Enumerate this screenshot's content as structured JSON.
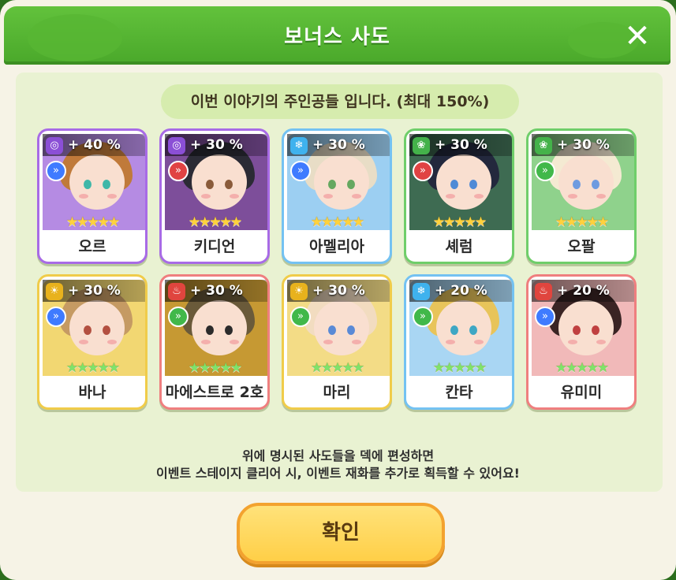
{
  "dialog": {
    "title": "보너스 사도",
    "close_icon": "close-icon",
    "banner": "이번 이야기의 주인공들 입니다. (최대 150%)",
    "description_line1": "위에 명시된 사도들을 덱에 편성하면",
    "description_line2": "이벤트 스테이지 클리어 시, 이벤트 재화를 추가로 획득할 수 있어요!",
    "confirm_label": "확인"
  },
  "characters": [
    {
      "name": "오르",
      "bonus": "+ 40 %",
      "element": "spiral",
      "element_color": "#8b4fd6",
      "rarity_stars": 5,
      "star_color": "yellow",
      "type_chip_color": "#3f7bff",
      "card_border": "#a86be6",
      "theme_bg": "#b58be3",
      "hair_color": "#c07a3a",
      "eye_color": "#3fb7a8"
    },
    {
      "name": "키디언",
      "bonus": "+ 30 %",
      "element": "spiral",
      "element_color": "#8b4fd6",
      "rarity_stars": 5,
      "star_color": "yellow",
      "type_chip_color": "#e04343",
      "card_border": "#a86be6",
      "theme_bg": "#7d4e9a",
      "hair_color": "#2b2b35",
      "eye_color": "#8a5b3a"
    },
    {
      "name": "아멜리아",
      "bonus": "+ 30 %",
      "element": "snowflake",
      "element_color": "#3fb2ee",
      "rarity_stars": 5,
      "star_color": "yellow",
      "type_chip_color": "#3f7bff",
      "card_border": "#74c2f2",
      "theme_bg": "#9ccff2",
      "hair_color": "#e8ddc6",
      "eye_color": "#65a860"
    },
    {
      "name": "셰럼",
      "bonus": "+ 30 %",
      "element": "leaf",
      "element_color": "#44b24a",
      "rarity_stars": 5,
      "star_color": "yellow",
      "type_chip_color": "#e04343",
      "card_border": "#6fce6a",
      "theme_bg": "#3e6b52",
      "hair_color": "#23283d",
      "eye_color": "#4f8ad6"
    },
    {
      "name": "오팔",
      "bonus": "+ 30 %",
      "element": "leaf",
      "element_color": "#44b24a",
      "rarity_stars": 5,
      "star_color": "yellow",
      "type_chip_color": "#41b84a",
      "card_border": "#6fce6a",
      "theme_bg": "#8fd28c",
      "hair_color": "#f4ead2",
      "eye_color": "#6e9be0"
    },
    {
      "name": "바나",
      "bonus": "+ 30 %",
      "element": "sun",
      "element_color": "#e8b21d",
      "rarity_stars": 5,
      "star_color": "green",
      "type_chip_color": "#3f7bff",
      "card_border": "#f0cc4a",
      "theme_bg": "#f2d772",
      "hair_color": "#c59a63",
      "eye_color": "#b35040"
    },
    {
      "name": "마에스트로 2호",
      "bonus": "+ 30 %",
      "element": "flame",
      "element_color": "#e0453e",
      "rarity_stars": 5,
      "star_color": "green",
      "type_chip_color": "#41b84a",
      "card_border": "#ef7f7f",
      "theme_bg": "#c69933",
      "hair_color": "#6a5a3a",
      "eye_color": "#2b2b2b"
    },
    {
      "name": "마리",
      "bonus": "+ 30 %",
      "element": "sun",
      "element_color": "#e8b21d",
      "rarity_stars": 5,
      "star_color": "green",
      "type_chip_color": "#41b84a",
      "card_border": "#f0cc4a",
      "theme_bg": "#f3dc86",
      "hair_color": "#f2dcc0",
      "eye_color": "#5a8ad6"
    },
    {
      "name": "칸타",
      "bonus": "+ 20 %",
      "element": "snowflake",
      "element_color": "#3fb2ee",
      "rarity_stars": 5,
      "star_color": "green",
      "type_chip_color": "#41b84a",
      "card_border": "#74c2f2",
      "theme_bg": "#a9d6f3",
      "hair_color": "#e8c45a",
      "eye_color": "#3ea7c4"
    },
    {
      "name": "유미미",
      "bonus": "+ 20 %",
      "element": "flame",
      "element_color": "#e0453e",
      "rarity_stars": 5,
      "star_color": "green",
      "type_chip_color": "#3f7bff",
      "card_border": "#ef7f7f",
      "theme_bg": "#f1b9b9",
      "hair_color": "#3a2424",
      "eye_color": "#c04040"
    }
  ]
}
